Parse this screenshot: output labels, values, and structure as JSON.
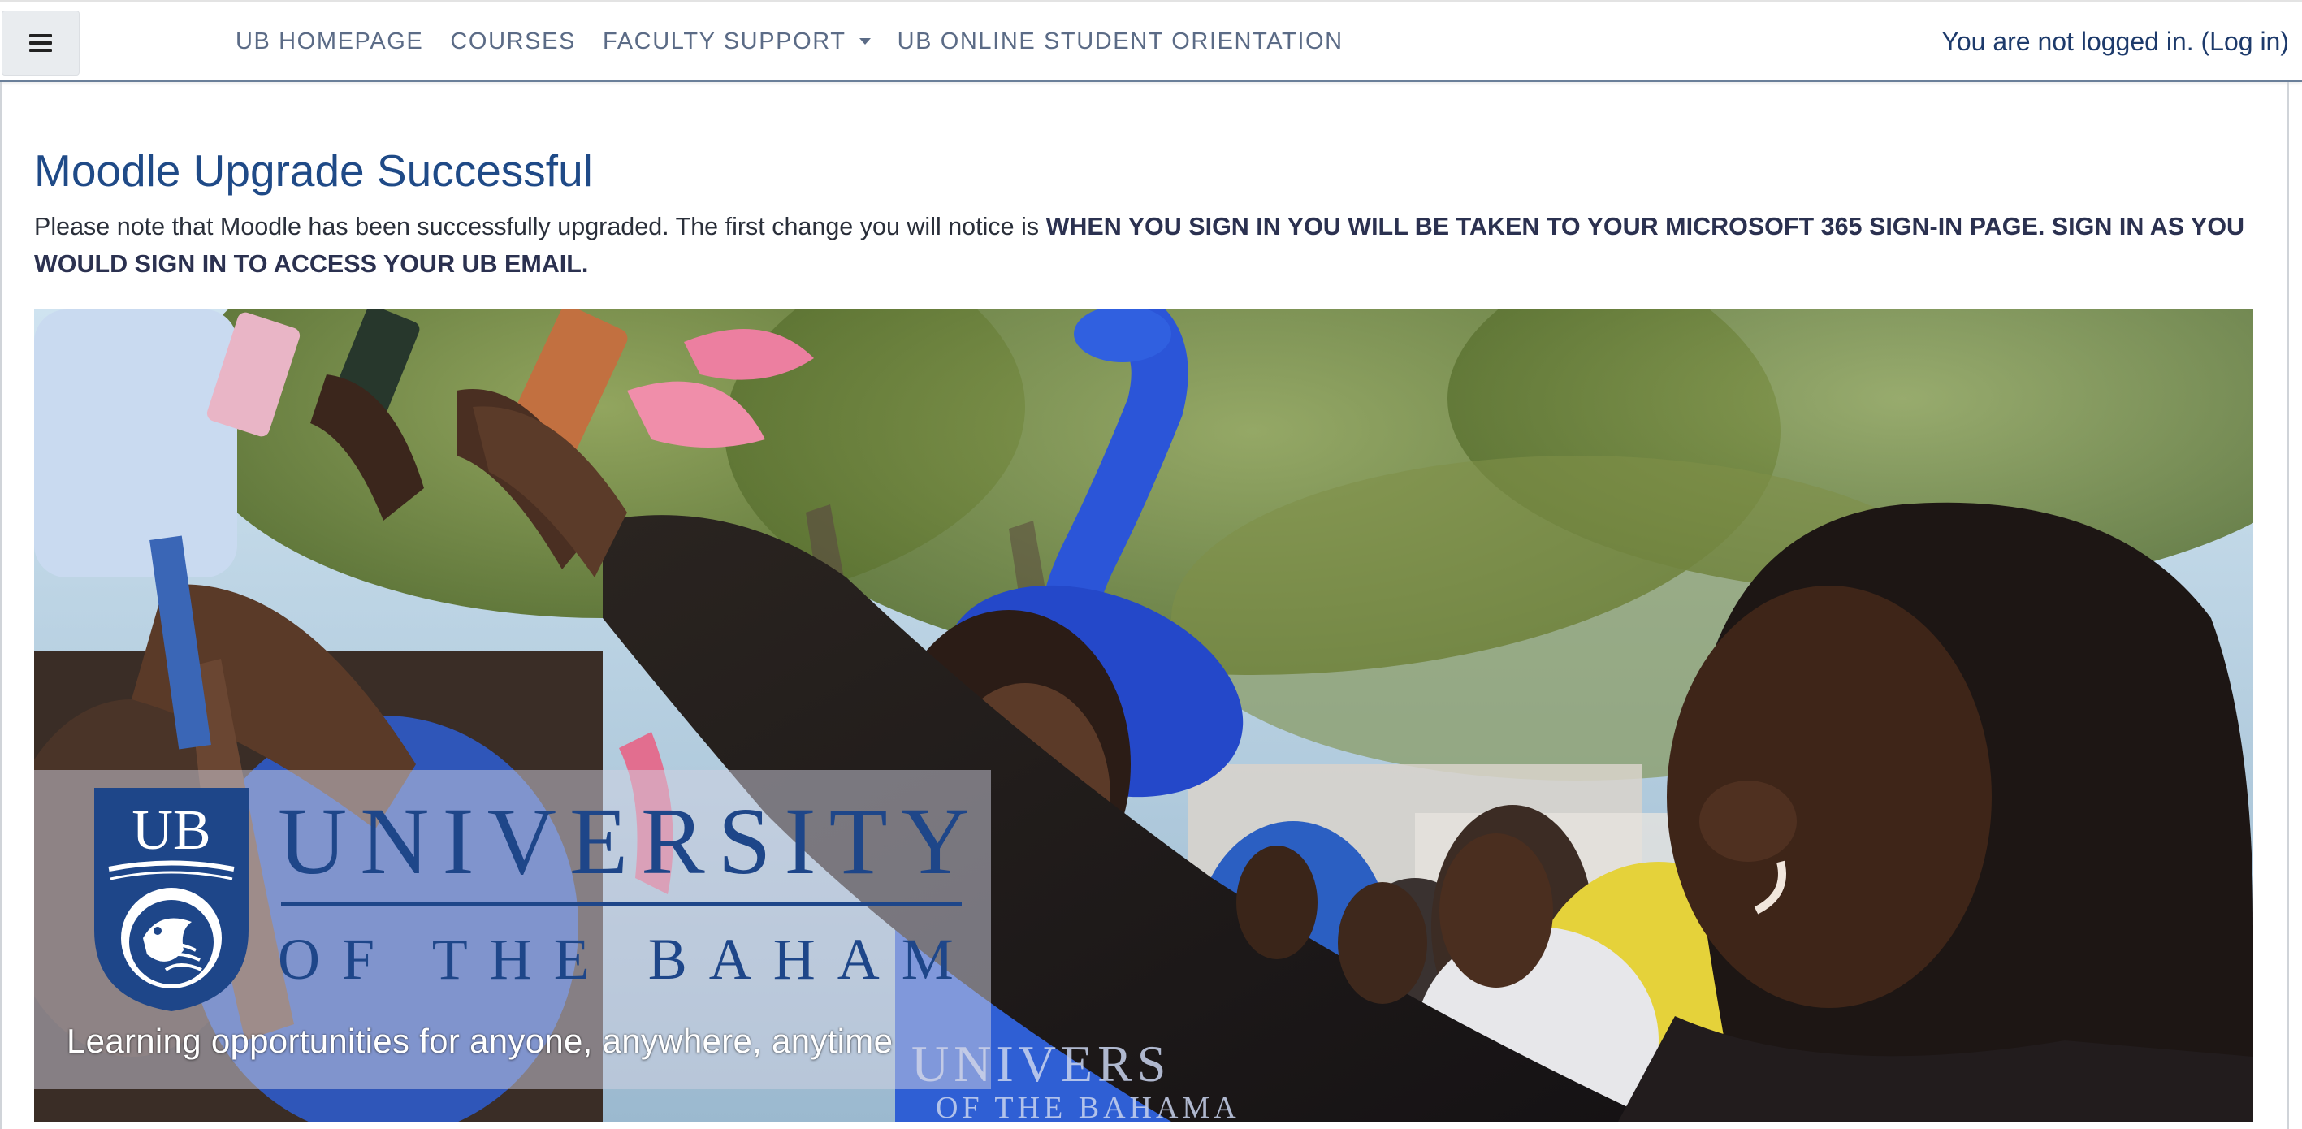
{
  "navbar": {
    "menu_toggle_icon": "hamburger-icon",
    "links": [
      {
        "label": "UB HOMEPAGE"
      },
      {
        "label": "COURSES"
      },
      {
        "label": "FACULTY SUPPORT",
        "has_dropdown": true
      },
      {
        "label": "UB ONLINE STUDENT ORIENTATION"
      }
    ],
    "login": {
      "prefix": "You are not logged in. (",
      "link_label": "Log in",
      "suffix": ")"
    }
  },
  "main": {
    "title": "Moodle Upgrade Successful",
    "notice_text": "Please note that Moodle has been successfully upgraded. The first change you will notice is ",
    "notice_bold": "WHEN YOU SIGN IN YOU WILL BE TAKEN TO YOUR MICROSOFT 365 SIGN-IN PAGE. SIGN IN AS YOU WOULD SIGN IN TO ACCESS YOUR UB EMAIL."
  },
  "banner": {
    "logo_initials": "UB",
    "logo_line1": "UNIVERSITY",
    "logo_line2": "OF THE BAHAMAS",
    "tagline": "Learning opportunities for anyone, anywhere, anytime"
  },
  "colors": {
    "title_blue": "#1f4a87",
    "nav_text": "#5b6b86",
    "logo_blue": "#1e4689"
  }
}
